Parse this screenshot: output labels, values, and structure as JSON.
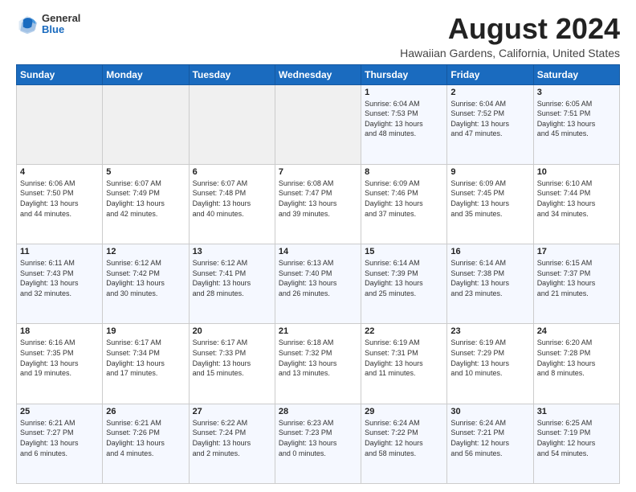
{
  "logo": {
    "general": "General",
    "blue": "Blue"
  },
  "header": {
    "title": "August 2024",
    "subtitle": "Hawaiian Gardens, California, United States"
  },
  "calendar": {
    "days_of_week": [
      "Sunday",
      "Monday",
      "Tuesday",
      "Wednesday",
      "Thursday",
      "Friday",
      "Saturday"
    ],
    "weeks": [
      [
        {
          "day": "",
          "detail": ""
        },
        {
          "day": "",
          "detail": ""
        },
        {
          "day": "",
          "detail": ""
        },
        {
          "day": "",
          "detail": ""
        },
        {
          "day": "1",
          "detail": "Sunrise: 6:04 AM\nSunset: 7:53 PM\nDaylight: 13 hours\nand 48 minutes."
        },
        {
          "day": "2",
          "detail": "Sunrise: 6:04 AM\nSunset: 7:52 PM\nDaylight: 13 hours\nand 47 minutes."
        },
        {
          "day": "3",
          "detail": "Sunrise: 6:05 AM\nSunset: 7:51 PM\nDaylight: 13 hours\nand 45 minutes."
        }
      ],
      [
        {
          "day": "4",
          "detail": "Sunrise: 6:06 AM\nSunset: 7:50 PM\nDaylight: 13 hours\nand 44 minutes."
        },
        {
          "day": "5",
          "detail": "Sunrise: 6:07 AM\nSunset: 7:49 PM\nDaylight: 13 hours\nand 42 minutes."
        },
        {
          "day": "6",
          "detail": "Sunrise: 6:07 AM\nSunset: 7:48 PM\nDaylight: 13 hours\nand 40 minutes."
        },
        {
          "day": "7",
          "detail": "Sunrise: 6:08 AM\nSunset: 7:47 PM\nDaylight: 13 hours\nand 39 minutes."
        },
        {
          "day": "8",
          "detail": "Sunrise: 6:09 AM\nSunset: 7:46 PM\nDaylight: 13 hours\nand 37 minutes."
        },
        {
          "day": "9",
          "detail": "Sunrise: 6:09 AM\nSunset: 7:45 PM\nDaylight: 13 hours\nand 35 minutes."
        },
        {
          "day": "10",
          "detail": "Sunrise: 6:10 AM\nSunset: 7:44 PM\nDaylight: 13 hours\nand 34 minutes."
        }
      ],
      [
        {
          "day": "11",
          "detail": "Sunrise: 6:11 AM\nSunset: 7:43 PM\nDaylight: 13 hours\nand 32 minutes."
        },
        {
          "day": "12",
          "detail": "Sunrise: 6:12 AM\nSunset: 7:42 PM\nDaylight: 13 hours\nand 30 minutes."
        },
        {
          "day": "13",
          "detail": "Sunrise: 6:12 AM\nSunset: 7:41 PM\nDaylight: 13 hours\nand 28 minutes."
        },
        {
          "day": "14",
          "detail": "Sunrise: 6:13 AM\nSunset: 7:40 PM\nDaylight: 13 hours\nand 26 minutes."
        },
        {
          "day": "15",
          "detail": "Sunrise: 6:14 AM\nSunset: 7:39 PM\nDaylight: 13 hours\nand 25 minutes."
        },
        {
          "day": "16",
          "detail": "Sunrise: 6:14 AM\nSunset: 7:38 PM\nDaylight: 13 hours\nand 23 minutes."
        },
        {
          "day": "17",
          "detail": "Sunrise: 6:15 AM\nSunset: 7:37 PM\nDaylight: 13 hours\nand 21 minutes."
        }
      ],
      [
        {
          "day": "18",
          "detail": "Sunrise: 6:16 AM\nSunset: 7:35 PM\nDaylight: 13 hours\nand 19 minutes."
        },
        {
          "day": "19",
          "detail": "Sunrise: 6:17 AM\nSunset: 7:34 PM\nDaylight: 13 hours\nand 17 minutes."
        },
        {
          "day": "20",
          "detail": "Sunrise: 6:17 AM\nSunset: 7:33 PM\nDaylight: 13 hours\nand 15 minutes."
        },
        {
          "day": "21",
          "detail": "Sunrise: 6:18 AM\nSunset: 7:32 PM\nDaylight: 13 hours\nand 13 minutes."
        },
        {
          "day": "22",
          "detail": "Sunrise: 6:19 AM\nSunset: 7:31 PM\nDaylight: 13 hours\nand 11 minutes."
        },
        {
          "day": "23",
          "detail": "Sunrise: 6:19 AM\nSunset: 7:29 PM\nDaylight: 13 hours\nand 10 minutes."
        },
        {
          "day": "24",
          "detail": "Sunrise: 6:20 AM\nSunset: 7:28 PM\nDaylight: 13 hours\nand 8 minutes."
        }
      ],
      [
        {
          "day": "25",
          "detail": "Sunrise: 6:21 AM\nSunset: 7:27 PM\nDaylight: 13 hours\nand 6 minutes."
        },
        {
          "day": "26",
          "detail": "Sunrise: 6:21 AM\nSunset: 7:26 PM\nDaylight: 13 hours\nand 4 minutes."
        },
        {
          "day": "27",
          "detail": "Sunrise: 6:22 AM\nSunset: 7:24 PM\nDaylight: 13 hours\nand 2 minutes."
        },
        {
          "day": "28",
          "detail": "Sunrise: 6:23 AM\nSunset: 7:23 PM\nDaylight: 13 hours\nand 0 minutes."
        },
        {
          "day": "29",
          "detail": "Sunrise: 6:24 AM\nSunset: 7:22 PM\nDaylight: 12 hours\nand 58 minutes."
        },
        {
          "day": "30",
          "detail": "Sunrise: 6:24 AM\nSunset: 7:21 PM\nDaylight: 12 hours\nand 56 minutes."
        },
        {
          "day": "31",
          "detail": "Sunrise: 6:25 AM\nSunset: 7:19 PM\nDaylight: 12 hours\nand 54 minutes."
        }
      ]
    ]
  }
}
